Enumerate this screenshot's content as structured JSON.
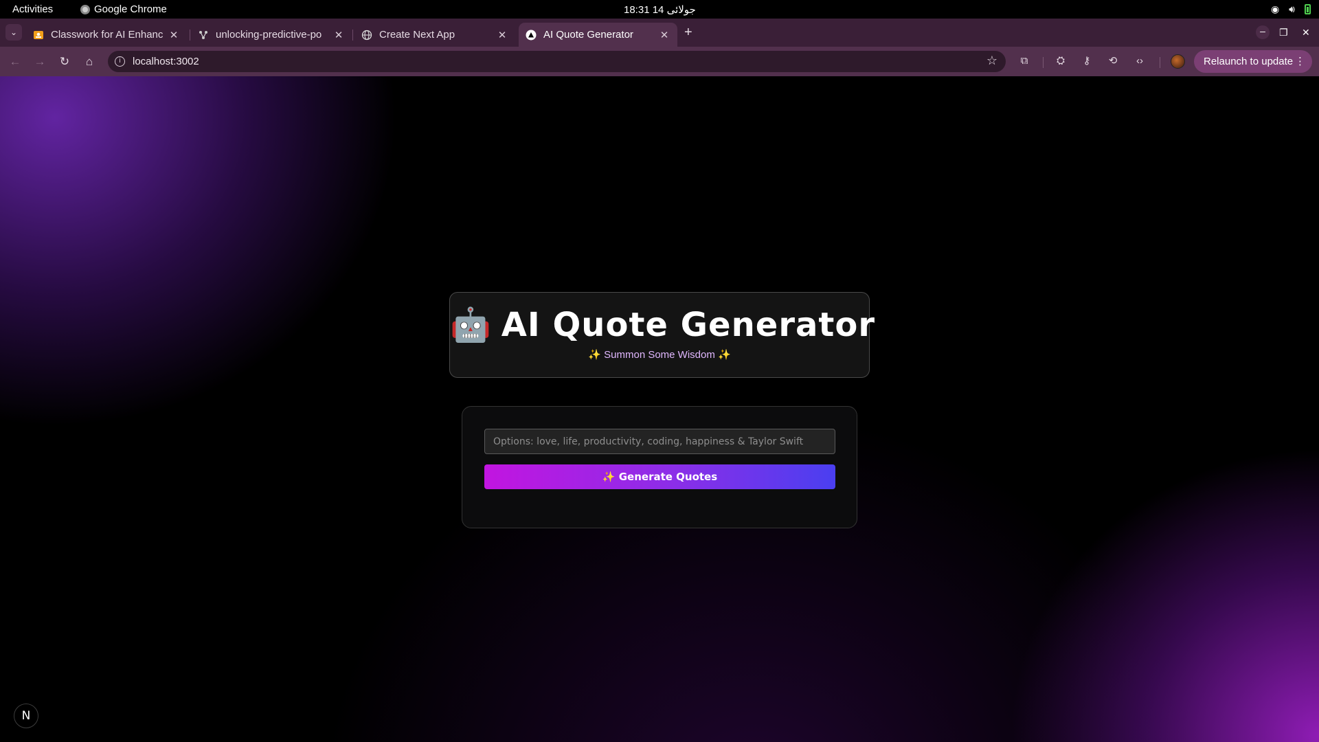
{
  "system": {
    "activities": "Activities",
    "app_name": "Google Chrome",
    "clock": "18:31  14 جولائی"
  },
  "tabs": [
    {
      "title": "Classwork for AI Enhanc",
      "favicon": "classroom-icon",
      "active": false
    },
    {
      "title": "unlocking-predictive-po",
      "favicon": "git-icon",
      "active": false
    },
    {
      "title": "Create Next App",
      "favicon": "globe-icon",
      "active": false
    },
    {
      "title": "AI Quote Generator",
      "favicon": "vercel-triangle-icon",
      "active": true
    }
  ],
  "toolbar": {
    "url": "localhost:3002",
    "relaunch_label": "Relaunch to update"
  },
  "page": {
    "title": "AI Quote Generator",
    "emoji": "🤖",
    "subtitle": "✨ Summon Some Wisdom ✨",
    "input_placeholder": "Options: love, life, productivity, coding, happiness & Taylor Swift",
    "input_value": "",
    "generate_label": "✨ Generate Quotes",
    "next_badge": "N"
  },
  "colors": {
    "accent_start": "#c215e0",
    "accent_end": "#4a3ff0",
    "subtitle": "#e1b8ff",
    "tab_strip": "#3a1f37",
    "toolbar": "#52304d"
  }
}
